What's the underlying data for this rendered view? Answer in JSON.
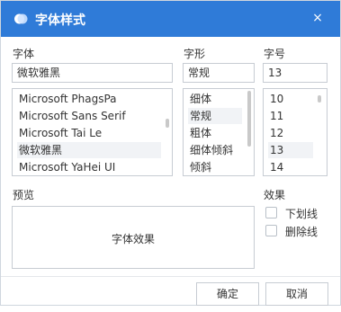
{
  "dialog": {
    "title": "字体样式",
    "close_icon": "×"
  },
  "font": {
    "label": "字体",
    "value": "微软雅黑",
    "items": [
      "Microsoft PhagsPa",
      "Microsoft Sans Serif",
      "Microsoft Tai Le",
      "微软雅黑",
      "Microsoft YaHei UI"
    ],
    "selected_index": 3
  },
  "style": {
    "label": "字形",
    "value": "常规",
    "items": [
      "细体",
      "常规",
      "粗体",
      "细体倾斜",
      "倾斜"
    ],
    "selected_index": 1
  },
  "size": {
    "label": "字号",
    "value": "13",
    "items": [
      "10",
      "11",
      "12",
      "13",
      "14"
    ],
    "selected_index": 3
  },
  "preview": {
    "label": "预览",
    "text": "字体效果"
  },
  "effects": {
    "label": "效果",
    "underline": {
      "label": "下划线",
      "checked": false
    },
    "strikethrough": {
      "label": "删除线",
      "checked": false
    }
  },
  "buttons": {
    "ok": "确定",
    "cancel": "取消"
  },
  "colors": {
    "titlebar": "#2f7bd8",
    "border": "#c7ccd3",
    "selection": "#f1f3f6"
  }
}
